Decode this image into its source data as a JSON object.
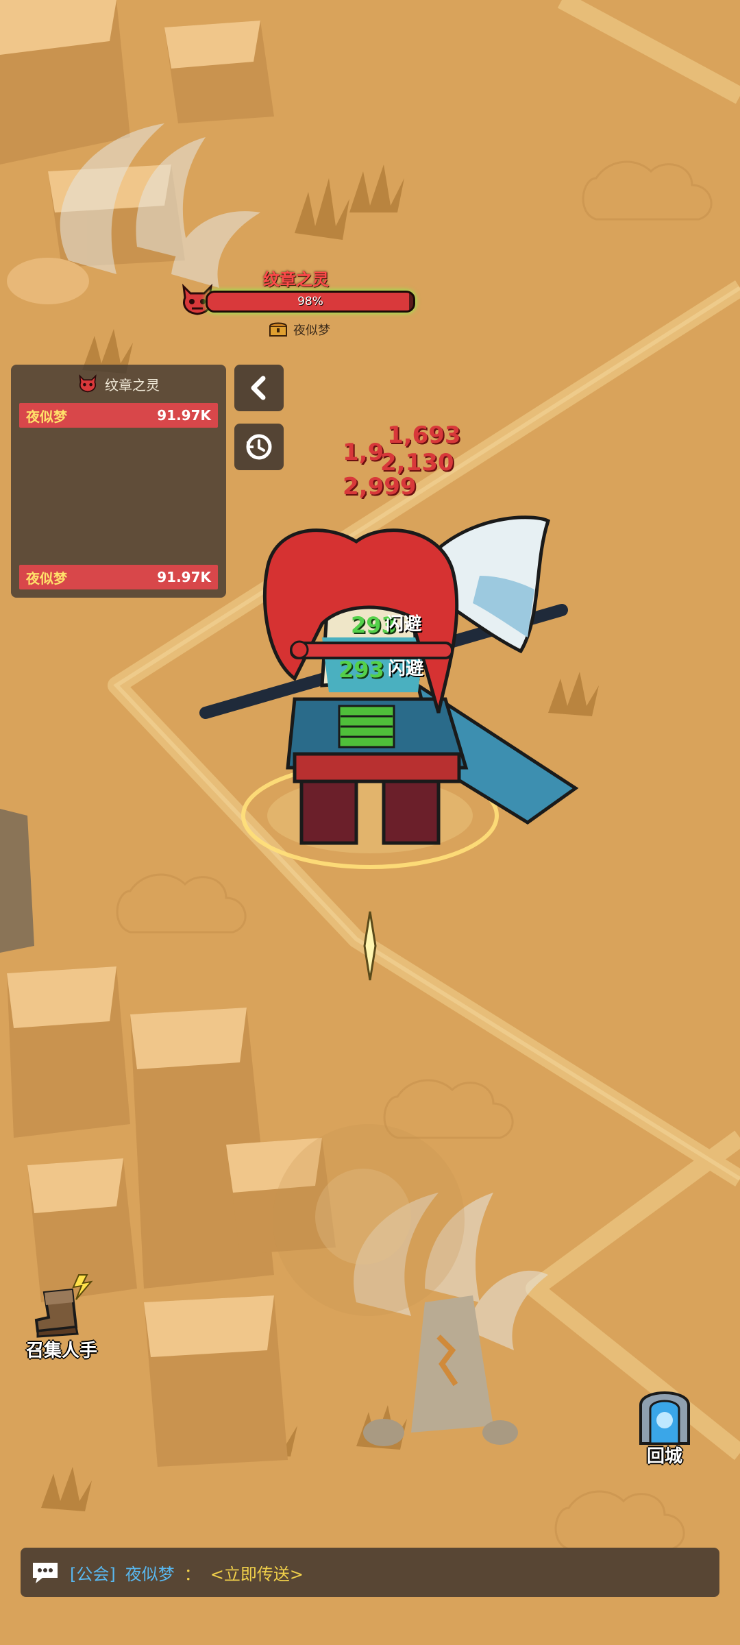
{
  "boss": {
    "name": "纹章之灵",
    "hp_percent": 98,
    "hp_text": "98%",
    "owner": "夜似梦"
  },
  "damage_panel": {
    "title": "纹章之灵",
    "rows": [
      {
        "name": "夜似梦",
        "value": "91.97K"
      }
    ],
    "footer": {
      "name": "夜似梦",
      "value": "91.97K"
    }
  },
  "floating_text": {
    "red_1": "1,9",
    "red_2": "1,693",
    "red_3": "2,130",
    "red_4": "2,999",
    "green_1": "293",
    "green_2": "293",
    "dodge_1": "闪避",
    "dodge_2": "闪避"
  },
  "buttons": {
    "recruit": "召集人手",
    "return_city": "回城"
  },
  "chat": {
    "channel": "[公会]",
    "sender": "夜似梦",
    "colon": "：",
    "message": "<立即传送>"
  },
  "colors": {
    "ground": "#d9a35b",
    "road": "#e9c07a",
    "rock": "#f0c68a",
    "hp_red": "#d9393b",
    "panel_row_red": "#d8474a",
    "chat_link": "#59b8f0",
    "chat_text": "#f1d04a"
  },
  "icons": {
    "boss": "demon-skull-icon",
    "owner": "treasure-chest-icon",
    "collapse": "chevron-left-icon",
    "history": "history-clock-icon",
    "recruit": "boot-lightning-icon",
    "return_city": "portal-gate-icon",
    "chat": "chat-bubble-icon"
  }
}
